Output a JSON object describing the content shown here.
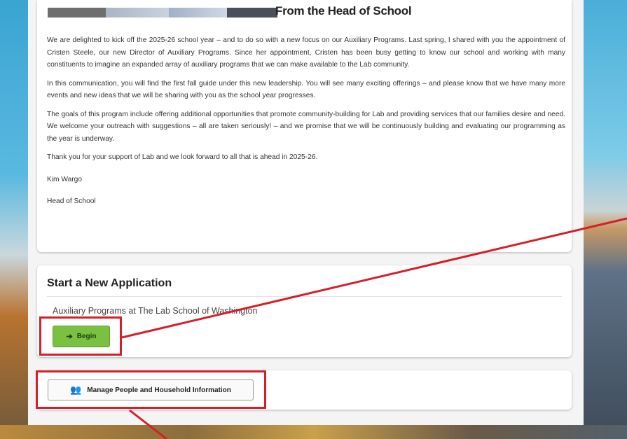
{
  "letter": {
    "title": "From the Head of School",
    "paragraphs": [
      "We are delighted to kick off the 2025-26 school year – and to do so with a new focus on our Auxiliary Programs. Last spring, I shared with you the appointment of Cristen Steele, our new Director of Auxiliary Programs. Since her appointment, Cristen has been busy getting to know our school and working with many constituents to imagine an expanded array of auxiliary programs that we can make available to the Lab community.",
      "In this communication, you will find the first fall guide under this new leadership. You will see many exciting offerings – and please know that we have many more events and new ideas that we will be sharing with you as the school year progresses.",
      "The goals of this program include offering additional opportunities that promote community-building for Lab and providing services that our families desire and need. We welcome your outreach with suggestions – all are taken seriously! – and we promise that we will be continuously building and evaluating our programming as the year is underway.",
      "Thank you for your support of Lab and we look forward to all that is ahead in 2025-26."
    ],
    "signature_name": "Kim Wargo",
    "signature_title": "Head of School"
  },
  "application": {
    "title": "Start a New Application",
    "program": "Auxiliary Programs at The Lab School of Washington",
    "begin_label": "Begin"
  },
  "manage": {
    "label": "Manage People and Household Information"
  },
  "colors": {
    "begin_green": "#7ac142",
    "annotation_red": "#d51f2a"
  },
  "icons": {
    "begin": "arrow-right-icon",
    "manage": "people-icon"
  }
}
